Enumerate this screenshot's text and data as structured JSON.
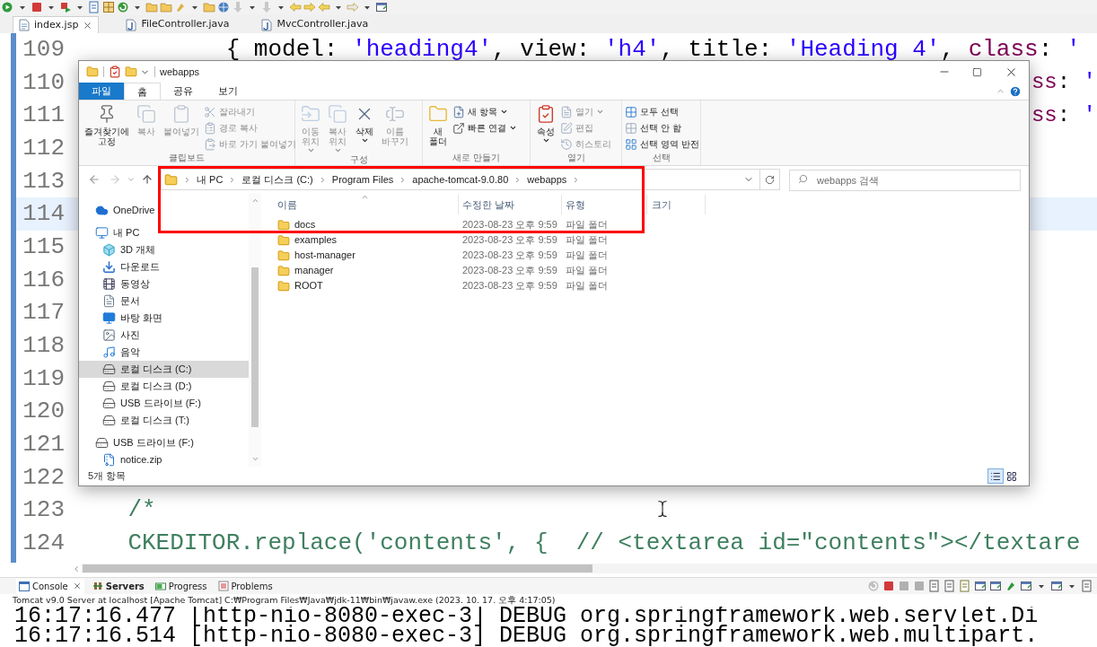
{
  "ide": {
    "editor_tabs": [
      {
        "label": "index.jsp",
        "kind": "jsp",
        "selected": true,
        "closable": true
      },
      {
        "label": "FileController.java",
        "kind": "java",
        "selected": false,
        "closable": false
      },
      {
        "label": "MvcController.java",
        "kind": "java",
        "selected": false,
        "closable": false
      }
    ],
    "code_lines": [
      {
        "number": "109",
        "kind": "full",
        "current": false,
        "segments": [
          {
            "text": "           { model: ",
            "kind": "plain"
          },
          {
            "text": "'heading4'",
            "kind": "string"
          },
          {
            "text": ", view: ",
            "kind": "plain"
          },
          {
            "text": "'h4'",
            "kind": "string"
          },
          {
            "text": ", title: ",
            "kind": "plain"
          },
          {
            "text": "'Heading 4'",
            "kind": "string"
          },
          {
            "text": ", ",
            "kind": "plain"
          },
          {
            "text": "class",
            "kind": "keyword"
          },
          {
            "text": ": ",
            "kind": "plain"
          },
          {
            "text": "'",
            "kind": "string"
          }
        ]
      },
      {
        "number": "110",
        "kind": "tail",
        "current": false,
        "segments": [
          {
            "text": "ss",
            "kind": "keyword"
          },
          {
            "text": ": ",
            "kind": "plain"
          },
          {
            "text": "'",
            "kind": "string"
          }
        ]
      },
      {
        "number": "111",
        "kind": "tail",
        "current": false,
        "segments": [
          {
            "text": "ss",
            "kind": "keyword"
          },
          {
            "text": ": ",
            "kind": "plain"
          },
          {
            "text": "'",
            "kind": "string"
          }
        ]
      },
      {
        "number": "112",
        "current": false
      },
      {
        "number": "113",
        "current": false
      },
      {
        "number": "114",
        "current": true
      },
      {
        "number": "115",
        "current": false
      },
      {
        "number": "116",
        "current": false
      },
      {
        "number": "117",
        "current": false
      },
      {
        "number": "118",
        "current": false
      },
      {
        "number": "119",
        "current": false
      },
      {
        "number": "120",
        "current": false
      },
      {
        "number": "121",
        "current": false
      },
      {
        "number": "122",
        "current": false
      },
      {
        "number": "123",
        "kind": "full",
        "current": false,
        "segments": [
          {
            "text": "    /*",
            "kind": "comment"
          }
        ]
      },
      {
        "number": "124",
        "kind": "full",
        "current": false,
        "segments": [
          {
            "text": "    CKEDITOR.replace('contents', {  // <textarea id=\"contents\"></textare",
            "kind": "comment"
          }
        ]
      }
    ],
    "console": {
      "tabs": [
        {
          "label": "Console",
          "selected": true,
          "updated": false
        },
        {
          "label": "Servers",
          "selected": false,
          "updated": true
        },
        {
          "label": "Progress",
          "selected": false,
          "updated": false
        },
        {
          "label": "Problems",
          "selected": false,
          "updated": false
        }
      ],
      "description": "Tomcat v9.0 Server at localhost [Apache Tomcat] C:₩Program Files₩Java₩jdk-11₩bin₩javaw.exe  (2023. 10. 17. 오후 4:17:05)",
      "lines": [
        "16:17:16.477 [http-nio-8080-exec-3] DEBUG org.springframework.web.servlet.Di",
        "16:17:16.514 [http-nio-8080-exec-3] DEBUG org.springframework.web.multipart."
      ]
    }
  },
  "explorer": {
    "title": "webapps",
    "ribbon_tabs": [
      {
        "label": "파일",
        "kind": "file",
        "selected": false
      },
      {
        "label": "홈",
        "kind": "tab",
        "selected": true
      },
      {
        "label": "공유",
        "kind": "tab",
        "selected": false
      },
      {
        "label": "보기",
        "kind": "tab",
        "selected": false
      }
    ],
    "ribbon_groups": [
      {
        "label": "클립보드",
        "commands": [
          {
            "label": "즐겨찾기에 고정",
            "kind": "large",
            "disabled": false,
            "dropdown": false
          },
          {
            "label": "복사",
            "kind": "large",
            "disabled": true,
            "dropdown": false
          },
          {
            "label": "붙여넣기",
            "kind": "large",
            "disabled": true,
            "dropdown": false
          },
          {
            "label": "잘라내기",
            "kind": "small",
            "disabled": true,
            "dropdown": false
          },
          {
            "label": "경로 복사",
            "kind": "small",
            "disabled": true,
            "dropdown": false
          },
          {
            "label": "바로 가기 붙여넣기",
            "kind": "small",
            "disabled": true,
            "dropdown": false
          }
        ]
      },
      {
        "label": "구성",
        "commands": [
          {
            "label": "이동 위치",
            "kind": "large",
            "disabled": true,
            "dropdown": true
          },
          {
            "label": "복사 위치",
            "kind": "large",
            "disabled": true,
            "dropdown": true
          },
          {
            "label": "삭제",
            "kind": "large",
            "disabled": false,
            "dropdown": true
          },
          {
            "label": "이름 바꾸기",
            "kind": "large",
            "disabled": true,
            "dropdown": false
          }
        ]
      },
      {
        "label": "새로 만들기",
        "commands": [
          {
            "label": "새 폴더",
            "kind": "large",
            "disabled": false,
            "dropdown": false
          },
          {
            "label": "새 항목",
            "kind": "small",
            "disabled": false,
            "dropdown": true
          },
          {
            "label": "빠른 연결",
            "kind": "small",
            "disabled": false,
            "dropdown": true
          }
        ]
      },
      {
        "label": "열기",
        "commands": [
          {
            "label": "속성",
            "kind": "large",
            "disabled": false,
            "dropdown": true
          },
          {
            "label": "열기",
            "kind": "small",
            "disabled": true,
            "dropdown": true
          },
          {
            "label": "편집",
            "kind": "small",
            "disabled": true,
            "dropdown": false
          },
          {
            "label": "히스토리",
            "kind": "small",
            "disabled": true,
            "dropdown": false
          }
        ]
      },
      {
        "label": "선택",
        "commands": [
          {
            "label": "모두 선택",
            "kind": "small",
            "disabled": false,
            "dropdown": false
          },
          {
            "label": "선택 안 함",
            "kind": "small",
            "disabled": false,
            "dropdown": false
          },
          {
            "label": "선택 영역 반전",
            "kind": "small",
            "disabled": false,
            "dropdown": false
          }
        ]
      }
    ],
    "address": {
      "path": [
        "내 PC",
        "로컬 디스크 (C:)",
        "Program Files",
        "apache-tomcat-9.0.80",
        "webapps"
      ],
      "search_placeholder": "webapps 검색"
    },
    "nav": [
      {
        "label": "OneDrive",
        "kind": "cloud",
        "selected": false
      },
      {
        "label": "내 PC",
        "kind": "pc",
        "selected": false,
        "children": [
          {
            "label": "3D 개체",
            "kind": "objects3d",
            "selected": false
          },
          {
            "label": "다운로드",
            "kind": "downloads",
            "selected": false
          },
          {
            "label": "동영상",
            "kind": "videos",
            "selected": false
          },
          {
            "label": "문서",
            "kind": "documents",
            "selected": false
          },
          {
            "label": "바탕 화면",
            "kind": "desktop",
            "selected": false
          },
          {
            "label": "사진",
            "kind": "pictures",
            "selected": false
          },
          {
            "label": "음악",
            "kind": "music",
            "selected": false
          },
          {
            "label": "로컬 디스크 (C:)",
            "kind": "drive",
            "selected": true
          },
          {
            "label": "로컬 디스크 (D:)",
            "kind": "drive",
            "selected": false
          },
          {
            "label": "USB 드라이브 (F:)",
            "kind": "drive",
            "selected": false
          },
          {
            "label": "로컬 디스크 (T:)",
            "kind": "drive",
            "selected": false
          }
        ]
      },
      {
        "label": "USB 드라이브 (F:)",
        "kind": "drive",
        "selected": false,
        "children": [
          {
            "label": "notice.zip",
            "kind": "archive",
            "selected": false
          }
        ]
      }
    ],
    "files": {
      "columns": [
        "이름",
        "수정한 날짜",
        "유형",
        "크기"
      ],
      "rows": [
        {
          "name": "docs",
          "modified": "2023-08-23 오후 9:59",
          "type": "파일 폴더"
        },
        {
          "name": "examples",
          "modified": "2023-08-23 오후 9:59",
          "type": "파일 폴더"
        },
        {
          "name": "host-manager",
          "modified": "2023-08-23 오후 9:59",
          "type": "파일 폴더"
        },
        {
          "name": "manager",
          "modified": "2023-08-23 오후 9:59",
          "type": "파일 폴더"
        },
        {
          "name": "ROOT",
          "modified": "2023-08-23 오후 9:59",
          "type": "파일 폴더"
        }
      ]
    },
    "status": "5개 항목",
    "view_modes": [
      {
        "selected": true
      },
      {
        "selected": false
      }
    ]
  }
}
